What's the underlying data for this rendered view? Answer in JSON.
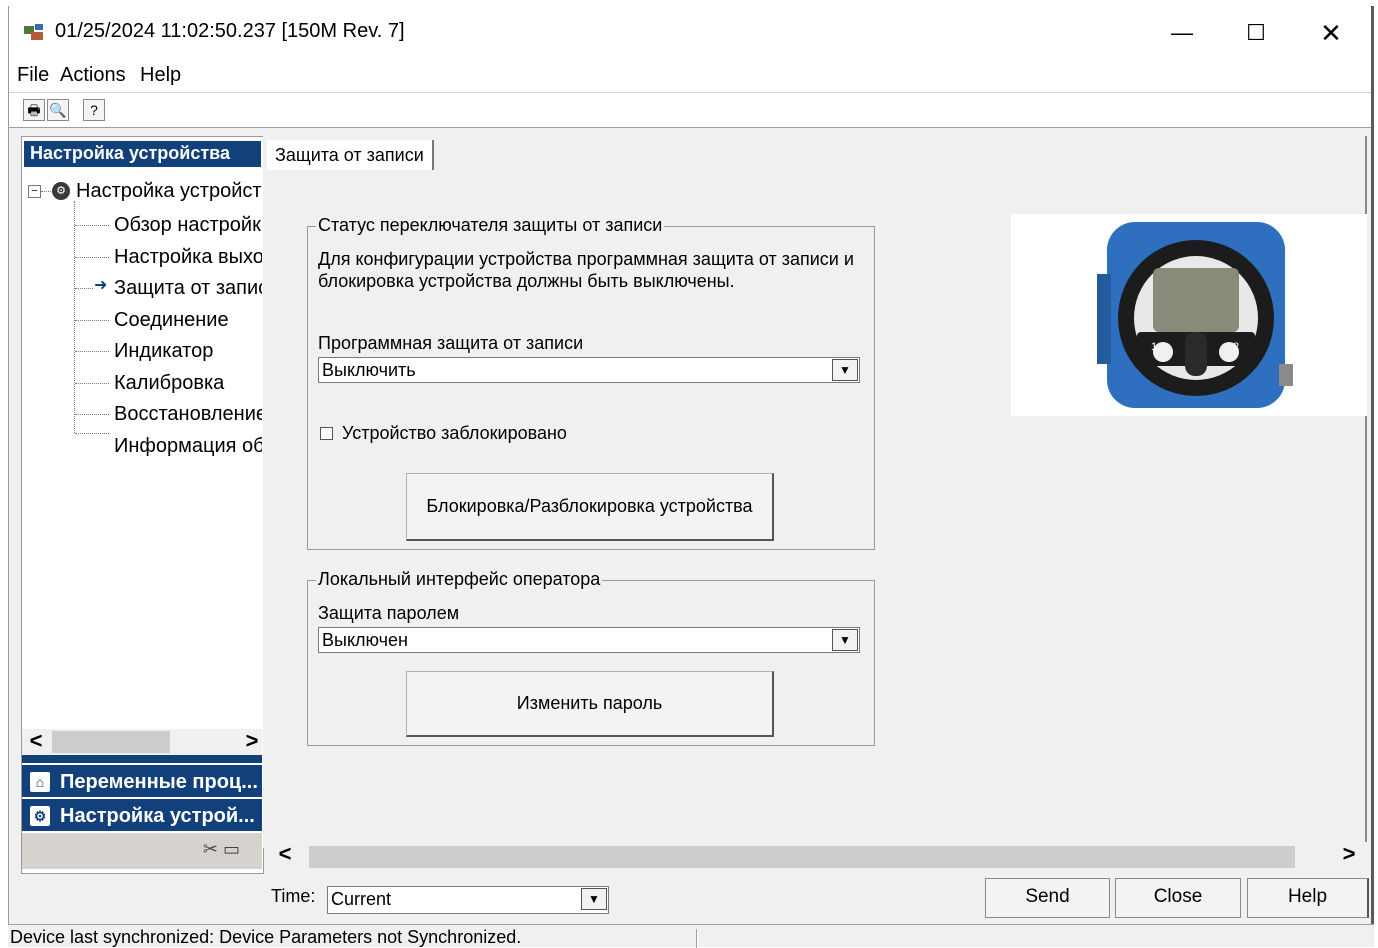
{
  "window": {
    "title": "01/25/2024 11:02:50.237 [150M Rev. 7]",
    "minimize": "—",
    "maximize": "☐",
    "close": "✕"
  },
  "menu": {
    "file": "File",
    "actions": "Actions",
    "help": "Help"
  },
  "toolbar": {
    "icons": [
      "print-icon",
      "print-preview-icon",
      "context-help-icon"
    ]
  },
  "left_panel": {
    "header": "Настройка устройства",
    "tree_root": "Настройка устройства",
    "tree_items": [
      {
        "label": "Обзор настройки"
      },
      {
        "label": "Настройка выхода"
      },
      {
        "label": "Защита от записи",
        "selected": true
      },
      {
        "label": "Соединение"
      },
      {
        "label": "Индикатор"
      },
      {
        "label": "Калибровка"
      },
      {
        "label": "Восстановление/"
      },
      {
        "label": "Информация об"
      }
    ],
    "scroll_left": "<",
    "scroll_right": ">",
    "nav_tabs": [
      {
        "label": "Переменные проц...",
        "icon": "home-icon"
      },
      {
        "label": "Настройка устрой...",
        "icon": "device-icon"
      }
    ]
  },
  "content": {
    "tab": "Защита от записи",
    "status_group": {
      "title": "Статус переключателя защиты от записи",
      "info_line1": "Для конфигурации устройства программная защита от записи и",
      "info_line2": "блокировка устройства должны быть выключены.",
      "sw_protect_label": "Программная защита от записи",
      "sw_protect_value": "Выключить",
      "locked_label": "Устройство заблокировано",
      "locked_checked": false,
      "lock_button": "Блокировка/Разблокировка устройства"
    },
    "local_group": {
      "title": "Локальный интерфейс оператора",
      "password_label": "Защита паролем",
      "password_value": "Выключен",
      "change_button": "Изменить пароль"
    },
    "device_image": {
      "dial_label_1": "1",
      "dial_label_2": "2",
      "color": "#2f6fc0"
    },
    "scroll_left": "<",
    "scroll_right": ">"
  },
  "bottom": {
    "time_label": "Time:",
    "time_value": "Current",
    "send": "Send",
    "close": "Close",
    "help": "Help"
  },
  "status": {
    "text": "Device last synchronized: Device Parameters not Synchronized."
  },
  "colors": {
    "nav_blue": "#12407a",
    "device_blue": "#2f6fc0"
  }
}
